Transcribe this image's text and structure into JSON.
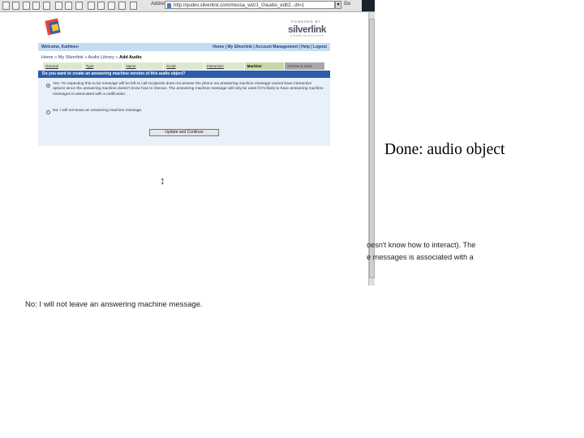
{
  "browser": {
    "address_label": "Address",
    "url": "http://qudev.silverlink.com/messa_wiz/1_0/audio_edit2...dt=1",
    "dropdown_arrow": "▾",
    "go_label": "Go"
  },
  "site": {
    "powered_by": "POWERED BY",
    "brand": "silverlink",
    "brand_sub": "COMMUNICATIONS",
    "welcome": "Welcome, Kathleen",
    "top_links": "Home | My Silverlink | Account Management | Help | Logout"
  },
  "breadcrumb": {
    "items": [
      "Home",
      "My Silverlink",
      "Audio Library"
    ],
    "separator": "»",
    "current": "Add Audio"
  },
  "steps": [
    {
      "label": "General",
      "state": "normal"
    },
    {
      "label": "Type",
      "state": "normal"
    },
    {
      "label": "Name",
      "state": "normal"
    },
    {
      "label": "Script",
      "state": "normal"
    },
    {
      "label": "Interaction",
      "state": "normal"
    },
    {
      "label": "Machine",
      "state": "active"
    },
    {
      "label": "Review & Save",
      "state": "done"
    }
  ],
  "form": {
    "question": "Do you want to create an answering machine version of this audio object?",
    "option_yes": "Yes: I'm expecting this to be message will be left to call recipients does not answer the phone via answering machine message cannot have interactive options since the answering machine doesn't know how to interact. The answering machine message will only be used if it's likely to have answering machine messages is associated with a notification.",
    "option_no": "No: I will not leave an answering machine message.",
    "option_yes_selected": true,
    "submit_label": "Update and Continue"
  },
  "slide": {
    "title": "Done: audio object",
    "fragment_1": "oesn't know how to interact).  The",
    "fragment_2": "e messages is associated with a",
    "no_option": "No: I will not leave an answering machine message."
  },
  "colors": {
    "nav_bar": "#c6dcf2",
    "question_bar": "#2c5cab",
    "form_bg": "#e8f0fa",
    "active_step": "#c4d9a6",
    "link": "#22447a"
  }
}
